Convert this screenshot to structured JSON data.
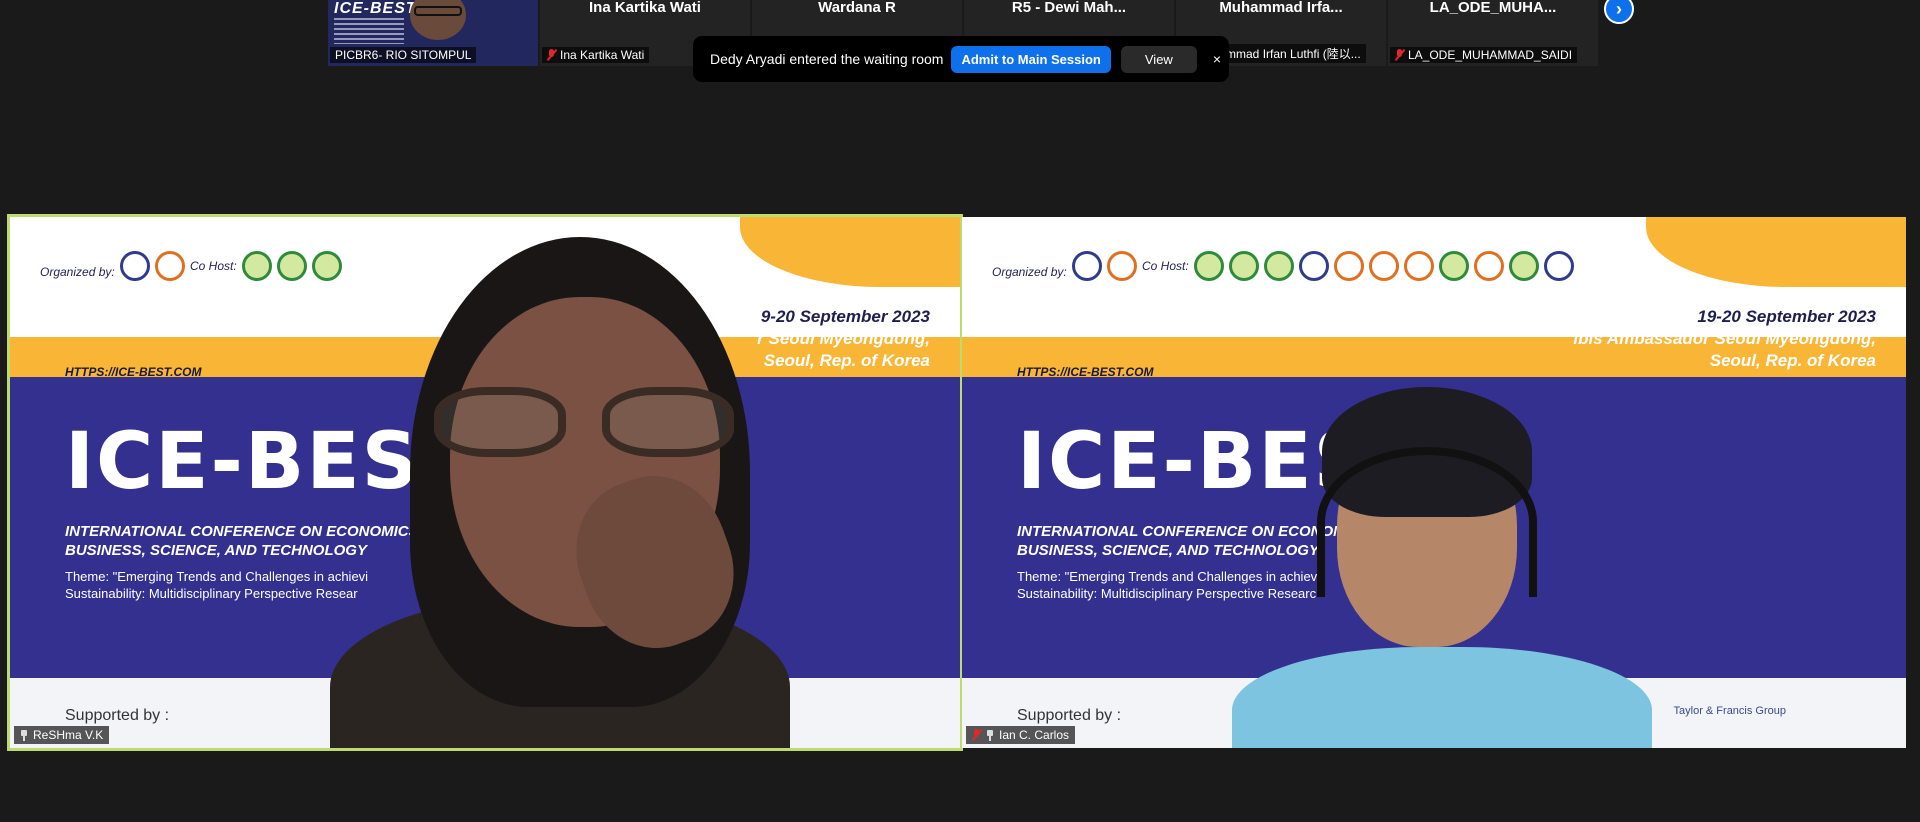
{
  "gallery": {
    "tiles": [
      {
        "label": "PICBR6- RIO SITOMPUL",
        "poster_text": "ICE-BEST"
      },
      {
        "name": "Ina Kartika Wati",
        "label": "Ina Kartika Wati"
      },
      {
        "name": "Wardana R",
        "label": "Wardana R"
      },
      {
        "name": "R5 - Dewi Mah...",
        "label": "R5 - Dewi Mah..."
      },
      {
        "name": "Muhammad Irfa...",
        "label": "Muhammad Irfan Luthfi (陸以..."
      },
      {
        "name": "LA_ODE_MUHA...",
        "label": "LA_ODE_MUHAMMAD_SAIDI"
      }
    ],
    "next_icon": "chevron-right-icon",
    "next_glyph": "›"
  },
  "notification": {
    "message": "Dedy Aryadi entered the waiting room",
    "admit_label": "Admit to Main Session",
    "view_label": "View",
    "close_glyph": "×"
  },
  "poster": {
    "organized_by": "Organized by:",
    "co_host": "Co Host:",
    "url": "HTTPS://ICE-BEST.COM",
    "title": "ICE-BEST",
    "subtitle_1": "INTERNATIONAL CONFERENCE ON ECONOMICS,",
    "subtitle_2": "BUSINESS, SCIENCE, AND TECHNOLOGY",
    "theme_1": "Theme: \"Emerging Trends and Challenges in achievi",
    "theme_2": "Sustainability: Multidisciplinary Perspective Resear",
    "date": "19-20 September 2023",
    "venue": "ibis Ambassador Seoul Myeongdong,",
    "city": "Seoul, Rep. of Korea",
    "supported_by": "Supported by :",
    "publisher": "Taylor & Francis Group"
  },
  "left_panel": {
    "date": "9-20 September 2023",
    "venue": "r Seoul Myeongdong,",
    "city": "Seoul, Rep. of Korea",
    "subtitle_1": "INTERNATIONAL CONFERENCE ON ECONOMICS,",
    "participant_name": "ReSHma V.K"
  },
  "right_panel": {
    "subtitle_1": "INTERNATIONAL CONFERENCE ON ECONOM",
    "theme_1": "Theme: \"Emerging Trends and Challenges in achievi",
    "theme_2": "Sustainability: Multidisciplinary Perspective Researc",
    "participant_name": "Ian C. Carlos"
  },
  "colors": {
    "accent_blue": "#0e71eb",
    "active_speaker_border": "#bddb6e",
    "poster_navy": "#34308f",
    "poster_yellow": "#f8b536",
    "muted_red": "#e02828"
  }
}
